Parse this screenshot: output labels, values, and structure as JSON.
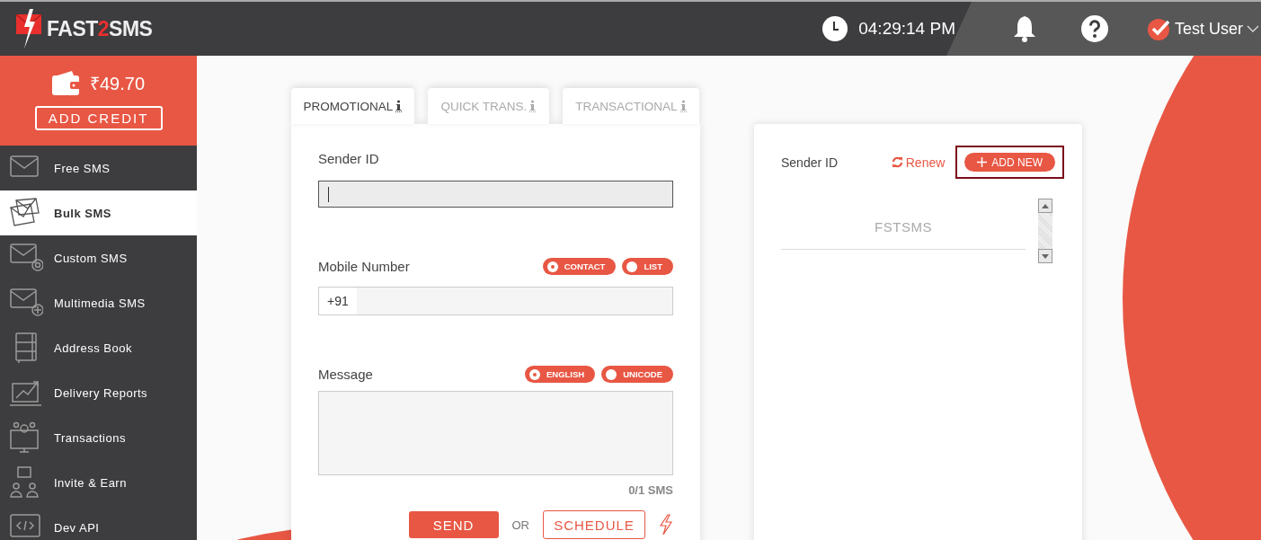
{
  "header": {
    "logo": {
      "parts": [
        {
          "text": "FAST",
          "accent": false
        },
        {
          "text": "2",
          "accent": true
        },
        {
          "text": "SMS",
          "accent": false
        }
      ]
    },
    "clock": "04:29:14 PM",
    "user": "Test User"
  },
  "wallet": {
    "balance": "₹49.70",
    "button": "ADD CREDIT"
  },
  "sidebar": {
    "items": [
      {
        "label": "Free SMS",
        "kind": "envelope",
        "selected": false
      },
      {
        "label": "Bulk SMS",
        "kind": "envelopes",
        "selected": true
      },
      {
        "label": "Custom SMS",
        "kind": "envelope-gear",
        "selected": false
      },
      {
        "label": "Multimedia SMS",
        "kind": "envelope-plus",
        "selected": false
      },
      {
        "label": "Address Book",
        "kind": "book",
        "selected": false
      },
      {
        "label": "Delivery Reports",
        "kind": "chart",
        "selected": false
      },
      {
        "label": "Transactions",
        "kind": "monitor",
        "selected": false
      },
      {
        "label": "Invite & Earn",
        "kind": "people",
        "selected": false
      },
      {
        "label": "Dev API",
        "kind": "code",
        "selected": false
      }
    ]
  },
  "tabs": [
    {
      "label": "PROMOTIONAL",
      "selected": true
    },
    {
      "label": "QUICK TRANS.",
      "selected": false
    },
    {
      "label": "TRANSACTIONAL",
      "selected": false
    }
  ],
  "form": {
    "sender_label": "Sender ID",
    "sender_focused": true,
    "mobile_label": "Mobile Number",
    "mobile_options": [
      {
        "label": "CONTACT",
        "selected": true
      },
      {
        "label": "LIST",
        "selected": false
      }
    ],
    "prefix": "+91",
    "message_label": "Message",
    "message_options": [
      {
        "label": "ENGLISH",
        "selected": true
      },
      {
        "label": "UNICODE",
        "selected": false
      }
    ],
    "counter": "0/1 SMS",
    "send": "SEND",
    "or": "OR",
    "schedule": "SCHEDULE"
  },
  "sender_panel": {
    "title": "Sender ID",
    "renew": "Renew",
    "add_new": "ADD NEW",
    "add_new_highlighted": true,
    "sender_ids": [
      "FSTSMS"
    ]
  }
}
